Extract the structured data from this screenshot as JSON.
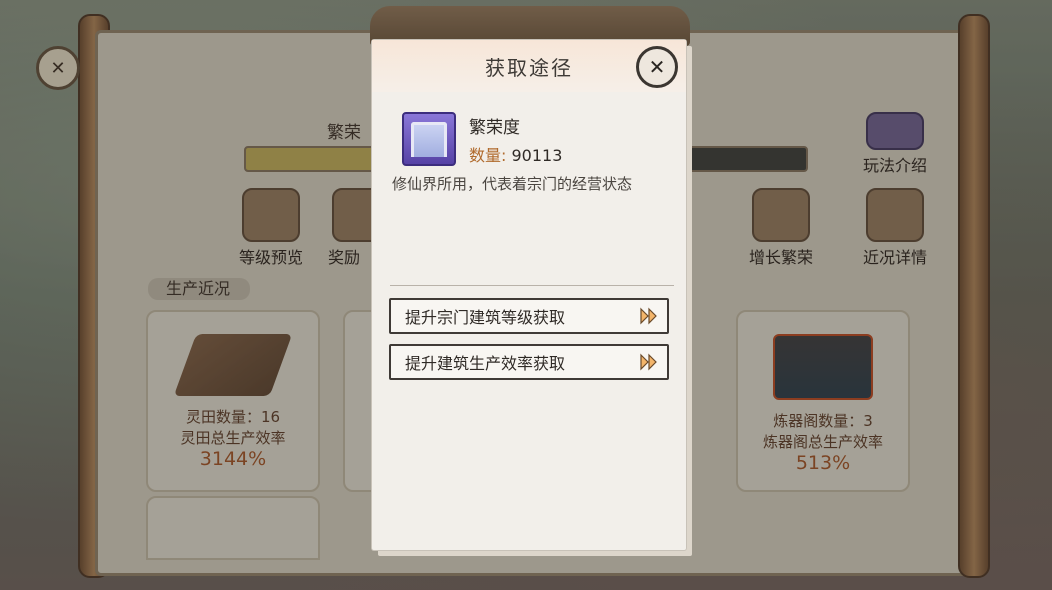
{
  "background": {
    "title_fragment": "繁荣",
    "prosperity_bar_fill": 0.34,
    "menu": [
      {
        "label": "等级预览",
        "icon": "pavilion-icon"
      },
      {
        "label": "奖励",
        "icon": "reward-chest-icon"
      },
      {
        "label": "增长繁荣",
        "icon": "growth-icon"
      },
      {
        "label": "近况详情",
        "icon": "scroll-details-icon"
      }
    ],
    "help_label": "玩法介绍",
    "section_title": "生产近况",
    "cards": [
      {
        "count_label": "灵田数量：16",
        "rate_label": "灵田总生产效率",
        "rate_value": "3144%"
      },
      {
        "count_label": "炼器阁数量：3",
        "rate_label": "炼器阁总生产效率",
        "rate_value": "513%"
      }
    ]
  },
  "popup": {
    "title": "获取途径",
    "item": {
      "name": "繁荣度",
      "quantity_label": "数量:",
      "quantity_value": "90113",
      "description": "修仙界所用，代表着宗门的经营状态"
    },
    "routes": [
      {
        "label": "提升宗门建筑等级获取"
      },
      {
        "label": "提升建筑生产效率获取"
      }
    ]
  },
  "colors": {
    "popup_bg": "#f2efea",
    "quantity_key": "#b06a2c",
    "rate_value": "#9c4f22"
  }
}
